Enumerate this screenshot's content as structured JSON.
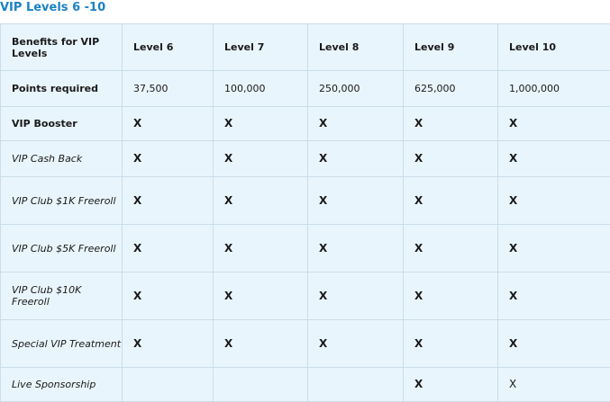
{
  "title": "VIP Levels 6 -10",
  "table": {
    "header": {
      "benefits": "Benefits for VIP Levels",
      "levels": [
        "Level 6",
        "Level 7",
        "Level 8",
        "Level 9",
        "Level 10"
      ]
    },
    "points_row": {
      "label": "Points required",
      "values": [
        "37,500",
        "100,000",
        "250,000",
        "625,000",
        "1,000,000"
      ]
    },
    "rows": [
      {
        "label": "VIP Booster",
        "cells": [
          "X",
          "X",
          "X",
          "X",
          "X"
        ]
      },
      {
        "label": "VIP Cash Back",
        "cells": [
          "X",
          "X",
          "X",
          "X",
          "X"
        ]
      },
      {
        "label": "VIP Club $1K Freeroll",
        "cells": [
          "X",
          "X",
          "X",
          "X",
          "X"
        ]
      },
      {
        "label": "VIP Club $5K Freeroll",
        "cells": [
          "X",
          "X",
          "X",
          "X",
          "X"
        ]
      },
      {
        "label": "VIP Club $10K Freeroll",
        "cells": [
          "X",
          "X",
          "X",
          "X",
          "X"
        ]
      },
      {
        "label": "Special VIP Treatment",
        "cells": [
          "X",
          "X",
          "X",
          "X",
          "X"
        ]
      },
      {
        "label": "Live Sponsorship",
        "cells": [
          "",
          "",
          "",
          "X",
          "X"
        ]
      }
    ]
  },
  "colors": {
    "title": "#1b82c4",
    "table_background": "#e9f5fc",
    "border": "#c9dde9"
  }
}
